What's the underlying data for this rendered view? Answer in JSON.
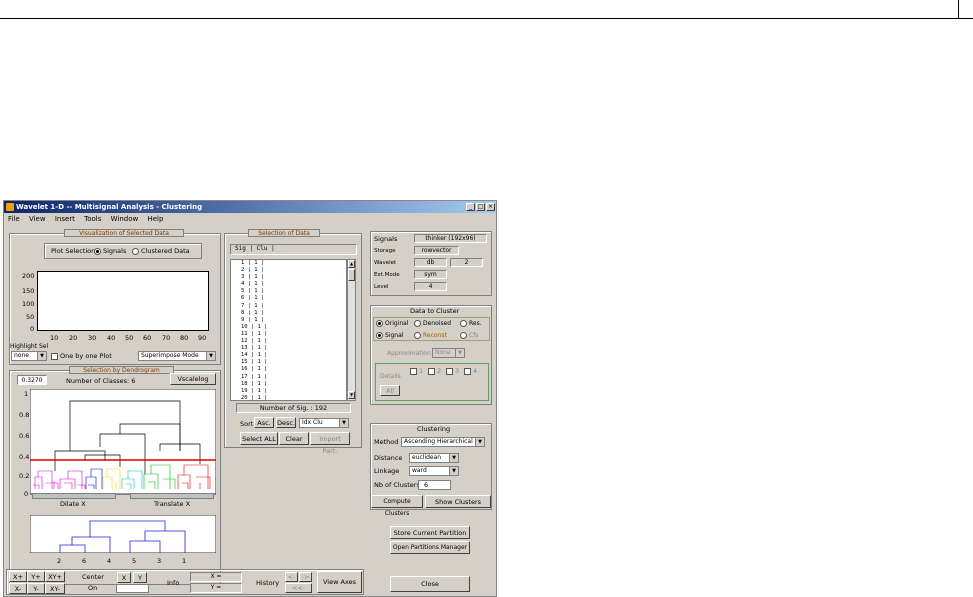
{
  "window": {
    "title": "Wavelet 1-D -- Multisignal Analysis - Clustering",
    "controls": [
      "_",
      "□",
      "×"
    ]
  },
  "menu": [
    "File",
    "View",
    "Insert",
    "Tools",
    "Window",
    "Help"
  ],
  "viz": {
    "title": "Visualization of Selected Data",
    "plot_selection_label": "Plot Selection:",
    "opt_signals": "Signals",
    "opt_clustered": "Clustered Data",
    "yticks": [
      "200",
      "150",
      "100",
      "50",
      "0"
    ],
    "xticks": [
      "10",
      "20",
      "30",
      "40",
      "50",
      "60",
      "70",
      "80",
      "90"
    ],
    "highlight_label": "Highlight Sel",
    "highlight_value": "none",
    "one_by_one": "One by one Plot",
    "mode_value": "Superimpose Mode"
  },
  "dendro": {
    "title": "Selection by Dendrogram",
    "threshold": "0.3270",
    "nb_classes": "Number of Classes: 6",
    "vscale_btn": "Vscalelog",
    "yticks": [
      "1",
      "0.8",
      "0.6",
      "0.4",
      "0.2",
      "0"
    ],
    "dilate": "Dilate X",
    "translate": "Translate X",
    "bottom_labels": [
      "2",
      "6",
      "4",
      "5",
      "3",
      "1"
    ]
  },
  "selection": {
    "title": "Selection of Data",
    "header": "Sig | Clu |",
    "rows": [
      "1  | 1  |",
      "2  | 1  |",
      "3  | 1  |",
      "4  | 1  |",
      "5  | 1  |",
      "6  | 1  |",
      "7  | 1  |",
      "8  | 1  |",
      "9  | 1  |",
      "10 | 1  |",
      "11 | 1  |",
      "12 | 1  |",
      "13 | 1  |",
      "14 | 1  |",
      "15 | 1  |",
      "16 | 1  |",
      "17 | 1  |",
      "18 | 1  |",
      "19 | 1  |",
      "20 | 1  |"
    ],
    "count": "Number of Sig. : 192",
    "sort": "Sort",
    "asc": "Asc.",
    "desc": "Desc.",
    "sort_by": "Idx Clu",
    "select_all": "Select ALL",
    "clear": "Clear",
    "import_part": "Import Part."
  },
  "info": {
    "signals_label": "Signals",
    "signals_value": "thinker (192x96)",
    "storage_label": "Storage",
    "storage_value": "rowvector",
    "wavelet_label": "Wavelet",
    "wavelet_value": "db",
    "wavelet_num": "2",
    "extmode_label": "Ext.Mode",
    "extmode_value": "sym",
    "level_label": "Level",
    "level_value": "4"
  },
  "data_to_cluster": {
    "title": "Data to Cluster",
    "original": "Original",
    "denoised": "Denoised",
    "res": "Res.",
    "signal": "Signal",
    "reconst": "Reconst",
    "cfs": "Cfs",
    "approx_label": "Approximation",
    "approx_value": "None",
    "details_label": "Details",
    "d1": "1",
    "d2": "2",
    "d3": "3",
    "d4": "4",
    "all": "All"
  },
  "clustering": {
    "title": "Clustering",
    "method_label": "Method",
    "method_value": "Ascending Hierarchical",
    "distance_label": "Distance",
    "distance_value": "euclidean",
    "linkage_label": "Linkage",
    "linkage_value": "ward",
    "nb_label": "Nb of Clusters",
    "nb_value": "6",
    "compute": "Compute Clusters",
    "show": "Show Clusters"
  },
  "partition": {
    "store": "Store Current Partition",
    "open": "Open Partitions Manager",
    "close": "Close"
  },
  "bottom": {
    "xplus": "X+",
    "yplus": "Y+",
    "xyplus": "XY+",
    "xminus": "X-",
    "yminus": "Y-",
    "xyminus": "XY-",
    "center": "Center",
    "on": "On",
    "x": "X",
    "y": "Y",
    "info": "Info",
    "xeq": "X =",
    "yeq": "Y =",
    "history": "History",
    "hist_back": "<-",
    "hist_fwd": "->",
    "hist_reset": "<<-",
    "view_axes": "View Axes"
  },
  "colors": {
    "titlebar_start": "#0a246a",
    "threshold_line": "#e00000",
    "panel_title": "#7a3a00"
  }
}
